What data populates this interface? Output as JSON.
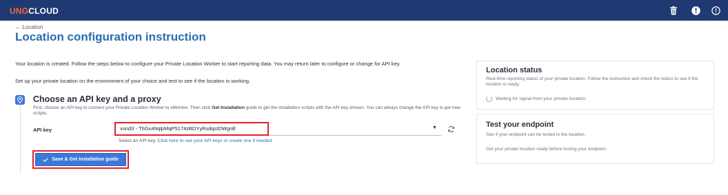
{
  "app": {
    "brand_prefix": "UNG",
    "brand_suffix": "CLOUD"
  },
  "header_icons": [
    "trash-icon",
    "info-icon",
    "alert-icon"
  ],
  "breadcrumb": {
    "back_arrow": "←",
    "label": "Location"
  },
  "page": {
    "title": "Location configuration instruction"
  },
  "intro": {
    "line1": "Your location is created. Follow the steps below to configure your Private Location Worker to start reporting data. You may return later to configure or change for API key.",
    "line2": "Set up your private location on the environment of your choice and test to see if the location is working."
  },
  "step": {
    "title": "Choose an API key and a proxy",
    "desc_part1": "First, choose an API key to connect your Private Location Worker to vMonitor. Then click ",
    "desc_bold": "Get Installation",
    "desc_part2": " guide to get the installation scripts with the API key chosen. You can always change the API key to get new scripts."
  },
  "api_key": {
    "label": "API key",
    "selected": "vund3 - ThGu49qlpMqP5174zBDYyRsdqstDWgnE",
    "helper_text": "Select an API key. ",
    "helper_link": "Click here to see your API keys or create one if needed."
  },
  "save_button": {
    "label": "Save & Get Installation guide"
  },
  "location_status": {
    "title": "Location status",
    "text": "Real-time reporting status of your private location. Follow the instruction and check the status to see if the location is ready.",
    "waiting": "Waiting for signal from your private location."
  },
  "test_endpoint": {
    "title": "Test your endpoint",
    "text1": "See if your endpoint can be tested in the location.",
    "text2": "Get your private location ready before testing your endpoint."
  },
  "colors": {
    "header_bg": "#1f3a73",
    "brand_accent": "#f26b3a",
    "primary": "#3b78d8",
    "title": "#2b6cb0",
    "highlight": "#e0202a"
  }
}
